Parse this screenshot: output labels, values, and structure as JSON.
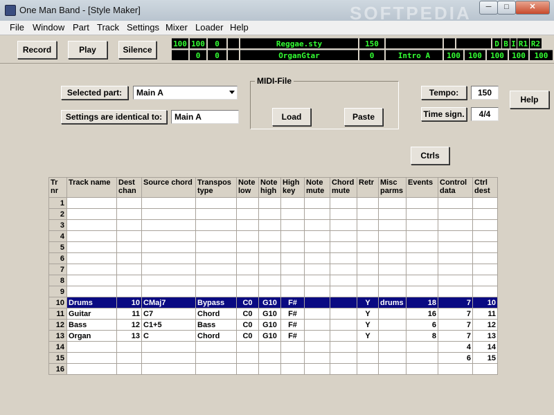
{
  "window": {
    "title": "One Man Band - [Style Maker]",
    "watermark": "SOFTPEDIA"
  },
  "menu": [
    "File",
    "Window",
    "Part",
    "Track",
    "Settings",
    "Mixer",
    "Loader",
    "Help"
  ],
  "toolbar": {
    "record_label": "Record",
    "play_label": "Play",
    "silence_label": "Silence"
  },
  "display": {
    "row1": [
      "100",
      "100",
      "0",
      "",
      "Reggae.sty",
      "150",
      "",
      "",
      "",
      "D",
      "B",
      "I",
      "R1",
      "R2"
    ],
    "row2": [
      "",
      "0",
      "0",
      "",
      "OrganGtar",
      "0",
      "Intro A",
      "100",
      "100",
      "100",
      "100",
      "100"
    ]
  },
  "form": {
    "selected_part_label": "Selected part:",
    "selected_part_value": "Main A",
    "identical_label": "Settings are identical to:",
    "identical_value": "Main A",
    "midi_group_title": "MIDI-File",
    "load_label": "Load",
    "paste_label": "Paste",
    "tempo_label": "Tempo:",
    "tempo_value": "150",
    "timesig_label": "Time sign.",
    "timesig_value": "4/4",
    "help_label": "Help",
    "ctrls_label": "Ctrls"
  },
  "grid": {
    "headers": [
      "Tr nr",
      "Track name",
      "Dest chan",
      "Source chord",
      "Transpos type",
      "Note low",
      "Note high",
      "High key",
      "Note mute",
      "Chord mute",
      "Retr",
      "Misc parms",
      "Events",
      "Control data",
      "Ctrl dest"
    ],
    "rows": [
      [
        "1",
        "",
        "",
        "",
        "",
        "",
        "",
        "",
        "",
        "",
        "",
        "",
        "",
        "",
        ""
      ],
      [
        "2",
        "",
        "",
        "",
        "",
        "",
        "",
        "",
        "",
        "",
        "",
        "",
        "",
        "",
        ""
      ],
      [
        "3",
        "",
        "",
        "",
        "",
        "",
        "",
        "",
        "",
        "",
        "",
        "",
        "",
        "",
        ""
      ],
      [
        "4",
        "",
        "",
        "",
        "",
        "",
        "",
        "",
        "",
        "",
        "",
        "",
        "",
        "",
        ""
      ],
      [
        "5",
        "",
        "",
        "",
        "",
        "",
        "",
        "",
        "",
        "",
        "",
        "",
        "",
        "",
        ""
      ],
      [
        "6",
        "",
        "",
        "",
        "",
        "",
        "",
        "",
        "",
        "",
        "",
        "",
        "",
        "",
        ""
      ],
      [
        "7",
        "",
        "",
        "",
        "",
        "",
        "",
        "",
        "",
        "",
        "",
        "",
        "",
        "",
        ""
      ],
      [
        "8",
        "",
        "",
        "",
        "",
        "",
        "",
        "",
        "",
        "",
        "",
        "",
        "",
        "",
        ""
      ],
      [
        "9",
        "",
        "",
        "",
        "",
        "",
        "",
        "",
        "",
        "",
        "",
        "",
        "",
        "",
        ""
      ],
      [
        "10",
        "Drums",
        "10",
        "CMaj7",
        "Bypass",
        "C0",
        "G10",
        "F#",
        "",
        "",
        "Y",
        "drums",
        "18",
        "7",
        "10"
      ],
      [
        "11",
        "Guitar",
        "11",
        "C7",
        "Chord",
        "C0",
        "G10",
        "F#",
        "",
        "",
        "Y",
        "",
        "16",
        "7",
        "11"
      ],
      [
        "12",
        "Bass",
        "12",
        "C1+5",
        "Bass",
        "C0",
        "G10",
        "F#",
        "",
        "",
        "Y",
        "",
        "6",
        "7",
        "12"
      ],
      [
        "13",
        "Organ",
        "13",
        "C",
        "Chord",
        "C0",
        "G10",
        "F#",
        "",
        "",
        "Y",
        "",
        "8",
        "7",
        "13"
      ],
      [
        "14",
        "",
        "",
        "",
        "",
        "",
        "",
        "",
        "",
        "",
        "",
        "",
        "",
        "4",
        "14"
      ],
      [
        "15",
        "",
        "",
        "",
        "",
        "",
        "",
        "",
        "",
        "",
        "",
        "",
        "",
        "6",
        "15"
      ],
      [
        "16",
        "",
        "",
        "",
        "",
        "",
        "",
        "",
        "",
        "",
        "",
        "",
        "",
        "",
        ""
      ]
    ],
    "selected_row": 9
  }
}
